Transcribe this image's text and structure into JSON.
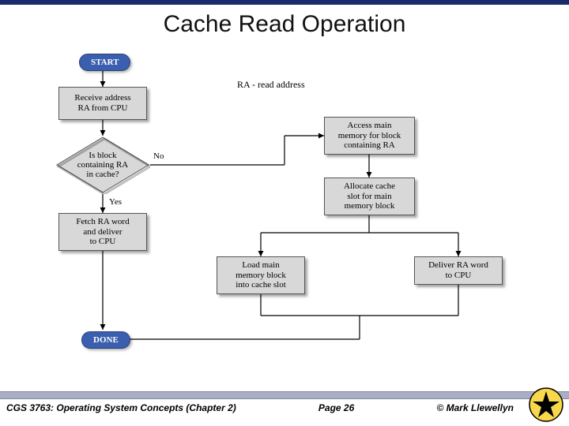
{
  "title": "Cache Read Operation",
  "note": "RA - read address",
  "nodes": {
    "start": "START",
    "receive": "Receive address\nRA from CPU",
    "decision": "Is block\ncontaining RA\nin cache?",
    "yes_label": "Yes",
    "no_label": "No",
    "fetch": "Fetch RA word\nand deliver\nto CPU",
    "access": "Access main\nmemory for block\ncontaining RA",
    "allocate": "Allocate cache\nslot for main\nmemory block",
    "load": "Load main\nmemory block\ninto cache slot",
    "deliver": "Deliver RA word\nto CPU",
    "done": "DONE"
  },
  "footer": {
    "course": "CGS 3763: Operating System Concepts  (Chapter 2)",
    "page": "Page 26",
    "credit": "© Mark Llewellyn"
  }
}
